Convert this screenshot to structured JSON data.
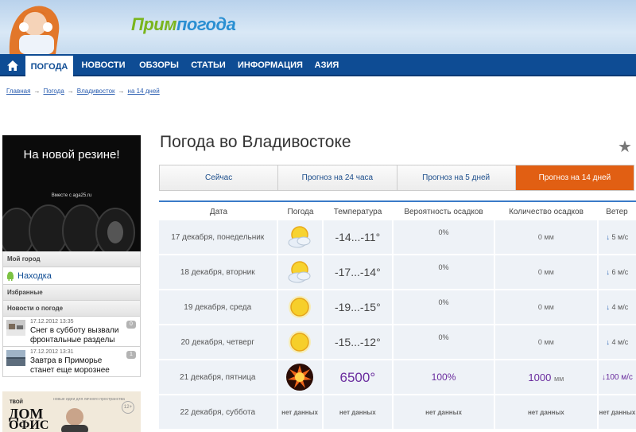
{
  "header": {
    "logo_part1": "Прим",
    "logo_part2": "погода"
  },
  "nav": {
    "items": [
      {
        "label": "ПОГОДА",
        "active": true
      },
      {
        "label": "НОВОСТИ"
      },
      {
        "label": "ОБЗОРЫ"
      },
      {
        "label": "СТАТЬИ"
      },
      {
        "label": "ИНФОРМАЦИЯ"
      },
      {
        "label": "АЗИЯ"
      }
    ]
  },
  "breadcrumb": [
    "Главная",
    "Погода",
    "Владивосток",
    "на 14 дней"
  ],
  "breadcrumb_sep": "→",
  "ad1": {
    "title": "На новой резине!",
    "subtitle": "Вместе с aga25.ru"
  },
  "sidebar": {
    "my_city_label": "Мой город",
    "city": "Находка",
    "favorites_label": "Избранные",
    "news_label": "Новости о погоде",
    "news": [
      {
        "date": "17.12.2012 13:35",
        "title": "Снег в субботу вызвали фронтальные разделы",
        "count": "0"
      },
      {
        "date": "17.12.2012 13:31",
        "title": "Завтра в Приморье станет еще морознее",
        "count": "1"
      }
    ]
  },
  "ad2": {
    "line1": "ТВОЙ",
    "line2": "ДОМ",
    "line3": "ОФИС",
    "tagline": "новые идеи для личного пространства",
    "age": "12+"
  },
  "page_title": "Погода во Владивостоке",
  "tabs": [
    {
      "label": "Сейчас"
    },
    {
      "label": "Прогноз на 24 часа"
    },
    {
      "label": "Прогноз на 5 дней"
    },
    {
      "label": "Прогноз на 14 дней",
      "active": true
    }
  ],
  "table": {
    "headers": [
      "Дата",
      "Погода",
      "Температура",
      "Вероятность осадков",
      "Количество осадков",
      "Ветер"
    ],
    "rows": [
      {
        "date": "17 декабря, понедельник",
        "icon": "partly-cloudy-icon",
        "temp": "-14...-11°",
        "prob": "0%",
        "amount": "0 мм",
        "wind_arrow": "↓",
        "wind": "5 м/с"
      },
      {
        "date": "18 декабря, вторник",
        "icon": "partly-cloudy-icon",
        "temp": "-17...-14°",
        "prob": "0%",
        "amount": "0 мм",
        "wind_arrow": "↓",
        "wind": "6 м/с"
      },
      {
        "date": "19 декабря, среда",
        "icon": "sun-icon",
        "temp": "-19...-15°",
        "prob": "0%",
        "amount": "0 мм",
        "wind_arrow": "↓",
        "wind": "4 м/с"
      },
      {
        "date": "20 декабря, четверг",
        "icon": "sun-icon",
        "temp": "-15...-12°",
        "prob": "0%",
        "amount": "0 мм",
        "wind_arrow": "↓",
        "wind": "4 м/с"
      },
      {
        "date": "21 декабря, пятница",
        "icon": "explosion-icon",
        "temp": "6500°",
        "prob": "100%",
        "amount_value": "1000",
        "amount_unit": "мм",
        "wind_arrow": "↓",
        "wind": "100 м/с"
      },
      {
        "date": "22 декабря, суббота",
        "no_data": "нет данных"
      }
    ]
  },
  "colors": {
    "nav_bg": "#0e4c94",
    "accent_tab": "#e15f13",
    "hot_text": "#6a2c9e",
    "cell_bg": "#eef2f7"
  }
}
